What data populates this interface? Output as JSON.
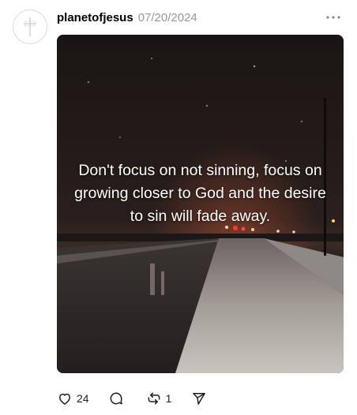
{
  "post": {
    "username": "planetofjesus",
    "timestamp": "07/20/2024",
    "caption": "Don't focus on not sinning, focus on growing closer to God and the desire to sin will fade away.",
    "actions": {
      "like_count": "24",
      "repost_count": "1"
    }
  },
  "icons": {
    "avatar": "cross-logo-icon",
    "more": "more-options-icon",
    "like": "heart-icon",
    "reply": "comment-icon",
    "repost": "repost-icon",
    "share": "send-icon"
  },
  "colors": {
    "text": "#000000",
    "muted": "#999999",
    "icon": "#1f1f1f"
  }
}
